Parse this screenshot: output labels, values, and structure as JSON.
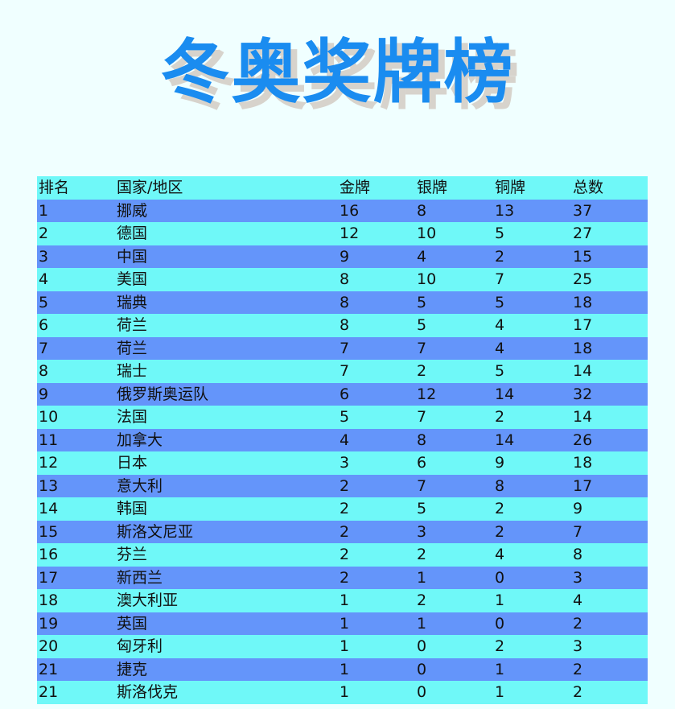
{
  "title": "冬奥奖牌榜",
  "table": {
    "headers": [
      "排名",
      "国家/地区",
      "金牌",
      "银牌",
      "铜牌",
      "总数"
    ],
    "rows": [
      [
        "1",
        "挪威",
        "16",
        "8",
        "13",
        "37"
      ],
      [
        "2",
        "德国",
        "12",
        "10",
        "5",
        "27"
      ],
      [
        "3",
        "中国",
        "9",
        "4",
        "2",
        "15"
      ],
      [
        "4",
        "美国",
        "8",
        "10",
        "7",
        "25"
      ],
      [
        "5",
        "瑞典",
        "8",
        "5",
        "5",
        "18"
      ],
      [
        "6",
        "荷兰",
        "8",
        "5",
        "4",
        "17"
      ],
      [
        "7",
        "荷兰",
        "7",
        "7",
        "4",
        "18"
      ],
      [
        "8",
        "瑞士",
        "7",
        "2",
        "5",
        "14"
      ],
      [
        "9",
        "俄罗斯奥运队",
        "6",
        "12",
        "14",
        "32"
      ],
      [
        "10",
        "法国",
        "5",
        "7",
        "2",
        "14"
      ],
      [
        "11",
        "加拿大",
        "4",
        "8",
        "14",
        "26"
      ],
      [
        "12",
        "日本",
        "3",
        "6",
        "9",
        "18"
      ],
      [
        "13",
        "意大利",
        "2",
        "7",
        "8",
        "17"
      ],
      [
        "14",
        "韩国",
        "2",
        "5",
        "2",
        "9"
      ],
      [
        "15",
        "斯洛文尼亚",
        "2",
        "3",
        "2",
        "7"
      ],
      [
        "16",
        "芬兰",
        "2",
        "2",
        "4",
        "8"
      ],
      [
        "17",
        "新西兰",
        "2",
        "1",
        "0",
        "3"
      ],
      [
        "18",
        "澳大利亚",
        "1",
        "2",
        "1",
        "4"
      ],
      [
        "19",
        "英国",
        "1",
        "1",
        "0",
        "2"
      ],
      [
        "20",
        "匈牙利",
        "1",
        "0",
        "2",
        "3"
      ],
      [
        "21",
        "捷克",
        "1",
        "0",
        "1",
        "2"
      ],
      [
        "21",
        "斯洛伐克",
        "1",
        "0",
        "1",
        "2"
      ]
    ]
  },
  "colors": {
    "background": "#f0ffff",
    "title": "#1a8cf0",
    "title_shadow": "#d7d3cc",
    "row_light": "#6ff8f8",
    "row_dark": "#6495fa"
  }
}
